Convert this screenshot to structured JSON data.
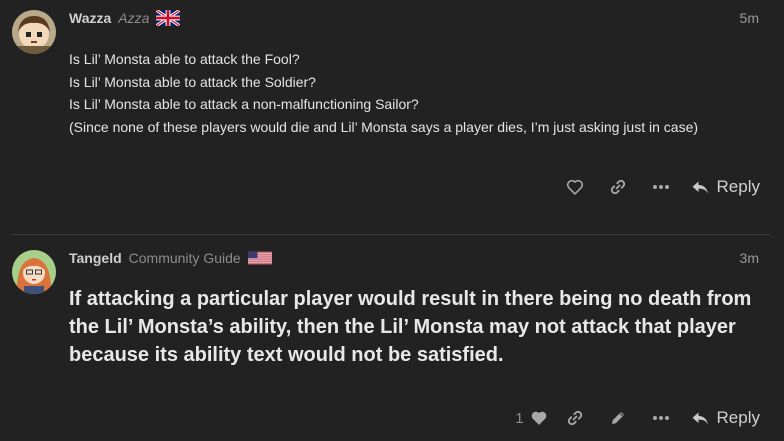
{
  "posts": [
    {
      "username": "Wazza",
      "user_title": "Azza",
      "flag": "uk-flag",
      "time": "5m",
      "lines": [
        "Is Lil’ Monsta able to attack the Fool?",
        "Is Lil’ Monsta able to attack the Soldier?",
        "Is Lil’ Monsta able to attack a non-malfunctioning Sailor?",
        "(Since none of these players would die and Lil’ Monsta says a player dies, I’m just asking just in case)"
      ],
      "actions": [
        "heart-icon",
        "link-icon",
        "more-icon",
        "reply-icon"
      ],
      "reply_label": "Reply"
    },
    {
      "username": "Tangeld",
      "user_title": "Community Guide",
      "flag": "us-flag",
      "time": "3m",
      "body": "If attacking a particular player would result in there being no death from the Lil’ Monsta’s ability, then the Lil’ Monsta may not attack that player because its ability text would not be satisfied.",
      "like_count": "1",
      "actions": [
        "heart-icon",
        "link-icon",
        "pencil-icon",
        "more-icon",
        "reply-icon"
      ],
      "reply_label": "Reply"
    }
  ],
  "colors": {
    "background": "#222222",
    "divider": "#3a3a3a",
    "icon": "#a8a8a8"
  }
}
